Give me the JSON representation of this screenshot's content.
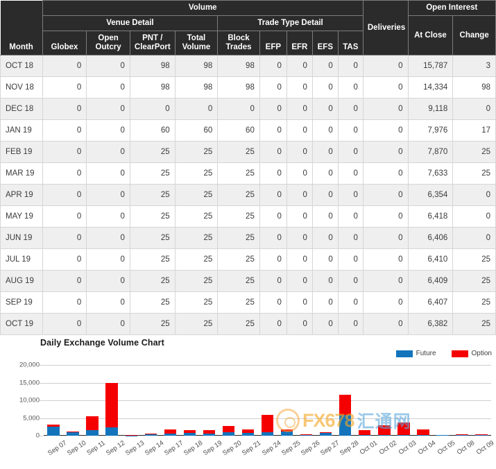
{
  "table": {
    "group_headers": {
      "volume": "Volume",
      "open_interest": "Open Interest",
      "venue_detail": "Venue Detail",
      "trade_type_detail": "Trade Type Detail"
    },
    "columns": [
      "Month",
      "Globex",
      "Open Outcry",
      "PNT / ClearPort",
      "Total Volume",
      "Block Trades",
      "EFP",
      "EFR",
      "EFS",
      "TAS",
      "Deliveries",
      "At Close",
      "Change"
    ],
    "column_labels": {
      "month": "Month",
      "globex": "Globex",
      "open_outcry_l1": "Open",
      "open_outcry_l2": "Outcry",
      "pnt_l1": "PNT /",
      "pnt_l2": "ClearPort",
      "total_volume_l1": "Total",
      "total_volume_l2": "Volume",
      "block_trades_l1": "Block",
      "block_trades_l2": "Trades",
      "efp": "EFP",
      "efr": "EFR",
      "efs": "EFS",
      "tas": "TAS",
      "deliveries": "Deliveries",
      "at_close": "At Close",
      "change": "Change"
    },
    "rows": [
      {
        "month": "OCT 18",
        "globex": "0",
        "open_outcry": "0",
        "pnt_clearport": "98",
        "total_volume": "98",
        "block_trades": "98",
        "efp": "0",
        "efr": "0",
        "efs": "0",
        "tas": "0",
        "deliveries": "0",
        "at_close": "15,787",
        "change": "3"
      },
      {
        "month": "NOV 18",
        "globex": "0",
        "open_outcry": "0",
        "pnt_clearport": "98",
        "total_volume": "98",
        "block_trades": "98",
        "efp": "0",
        "efr": "0",
        "efs": "0",
        "tas": "0",
        "deliveries": "0",
        "at_close": "14,334",
        "change": "98"
      },
      {
        "month": "DEC 18",
        "globex": "0",
        "open_outcry": "0",
        "pnt_clearport": "0",
        "total_volume": "0",
        "block_trades": "0",
        "efp": "0",
        "efr": "0",
        "efs": "0",
        "tas": "0",
        "deliveries": "0",
        "at_close": "9,118",
        "change": "0"
      },
      {
        "month": "JAN 19",
        "globex": "0",
        "open_outcry": "0",
        "pnt_clearport": "60",
        "total_volume": "60",
        "block_trades": "60",
        "efp": "0",
        "efr": "0",
        "efs": "0",
        "tas": "0",
        "deliveries": "0",
        "at_close": "7,976",
        "change": "17"
      },
      {
        "month": "FEB 19",
        "globex": "0",
        "open_outcry": "0",
        "pnt_clearport": "25",
        "total_volume": "25",
        "block_trades": "25",
        "efp": "0",
        "efr": "0",
        "efs": "0",
        "tas": "0",
        "deliveries": "0",
        "at_close": "7,870",
        "change": "25"
      },
      {
        "month": "MAR 19",
        "globex": "0",
        "open_outcry": "0",
        "pnt_clearport": "25",
        "total_volume": "25",
        "block_trades": "25",
        "efp": "0",
        "efr": "0",
        "efs": "0",
        "tas": "0",
        "deliveries": "0",
        "at_close": "7,633",
        "change": "25"
      },
      {
        "month": "APR 19",
        "globex": "0",
        "open_outcry": "0",
        "pnt_clearport": "25",
        "total_volume": "25",
        "block_trades": "25",
        "efp": "0",
        "efr": "0",
        "efs": "0",
        "tas": "0",
        "deliveries": "0",
        "at_close": "6,354",
        "change": "0"
      },
      {
        "month": "MAY 19",
        "globex": "0",
        "open_outcry": "0",
        "pnt_clearport": "25",
        "total_volume": "25",
        "block_trades": "25",
        "efp": "0",
        "efr": "0",
        "efs": "0",
        "tas": "0",
        "deliveries": "0",
        "at_close": "6,418",
        "change": "0"
      },
      {
        "month": "JUN 19",
        "globex": "0",
        "open_outcry": "0",
        "pnt_clearport": "25",
        "total_volume": "25",
        "block_trades": "25",
        "efp": "0",
        "efr": "0",
        "efs": "0",
        "tas": "0",
        "deliveries": "0",
        "at_close": "6,406",
        "change": "0"
      },
      {
        "month": "JUL 19",
        "globex": "0",
        "open_outcry": "0",
        "pnt_clearport": "25",
        "total_volume": "25",
        "block_trades": "25",
        "efp": "0",
        "efr": "0",
        "efs": "0",
        "tas": "0",
        "deliveries": "0",
        "at_close": "6,410",
        "change": "25"
      },
      {
        "month": "AUG 19",
        "globex": "0",
        "open_outcry": "0",
        "pnt_clearport": "25",
        "total_volume": "25",
        "block_trades": "25",
        "efp": "0",
        "efr": "0",
        "efs": "0",
        "tas": "0",
        "deliveries": "0",
        "at_close": "6,409",
        "change": "25"
      },
      {
        "month": "SEP 19",
        "globex": "0",
        "open_outcry": "0",
        "pnt_clearport": "25",
        "total_volume": "25",
        "block_trades": "25",
        "efp": "0",
        "efr": "0",
        "efs": "0",
        "tas": "0",
        "deliveries": "0",
        "at_close": "6,407",
        "change": "25"
      },
      {
        "month": "OCT 19",
        "globex": "0",
        "open_outcry": "0",
        "pnt_clearport": "25",
        "total_volume": "25",
        "block_trades": "25",
        "efp": "0",
        "efr": "0",
        "efs": "0",
        "tas": "0",
        "deliveries": "0",
        "at_close": "6,382",
        "change": "25"
      }
    ]
  },
  "watermark": {
    "brand": "FX678",
    "cn": "汇通网"
  },
  "chart_data": {
    "type": "bar",
    "stacked": true,
    "title": "Daily Exchange Volume Chart",
    "xlabel": "",
    "ylabel": "",
    "ylim": [
      0,
      20000
    ],
    "yticks": [
      "0",
      "5,000",
      "10,000",
      "15,000",
      "20,000"
    ],
    "ytick_values": [
      0,
      5000,
      10000,
      15000,
      20000
    ],
    "grid": true,
    "legend_position": "top-right",
    "colors": {
      "future": "#1374bc",
      "option": "#f50000"
    },
    "categories": [
      "Sep 07",
      "Sep 10",
      "Sep 11",
      "Sep 12",
      "Sep 13",
      "Sep 14",
      "Sep 17",
      "Sep 18",
      "Sep 19",
      "Sep 20",
      "Sep 21",
      "Sep 24",
      "Sep 25",
      "Sep 26",
      "Sep 27",
      "Sep 28",
      "Oct 01",
      "Oct 02",
      "Oct 03",
      "Oct 04",
      "Oct 05",
      "Oct 08",
      "Oct 09"
    ],
    "series": [
      {
        "name": "Future",
        "color": "#1374bc",
        "values": [
          2500,
          900,
          1600,
          2350,
          100,
          450,
          500,
          750,
          650,
          1050,
          700,
          900,
          1150,
          250,
          750,
          5900,
          200,
          150,
          200,
          150,
          150,
          200,
          200
        ]
      },
      {
        "name": "Option",
        "color": "#f50000",
        "values": [
          700,
          250,
          3800,
          12600,
          100,
          100,
          1200,
          750,
          900,
          1700,
          1150,
          5000,
          600,
          100,
          150,
          5700,
          1300,
          2800,
          3600,
          1600,
          100,
          100,
          100
        ]
      }
    ]
  }
}
